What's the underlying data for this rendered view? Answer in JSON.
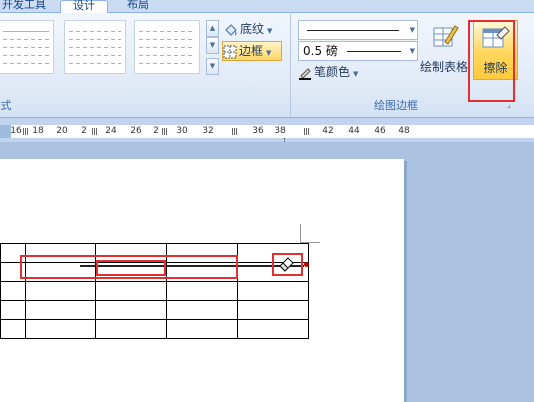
{
  "tabs": {
    "dev_tools": "开发工具",
    "design": "设计",
    "layout": "布局"
  },
  "styles_group": {
    "label": "式"
  },
  "shading": {
    "label": "底纹",
    "icon": "paint-bucket-icon"
  },
  "borders": {
    "label": "边框",
    "icon": "borders-grid-icon"
  },
  "draw_borders_group": {
    "label": "绘图边框",
    "line_weight": "0.5 磅",
    "pen_color": "笔颜色",
    "draw_table": "绘制表格",
    "eraser": "擦除"
  },
  "ruler_ticks": [
    "16",
    "18",
    "20",
    "2",
    "24",
    "26",
    "2",
    "30",
    "32",
    "36",
    "38",
    "42",
    "44",
    "46",
    "48"
  ],
  "colors": {
    "highlight_red": "#e32f2f",
    "active_button": "#ffd75e"
  }
}
